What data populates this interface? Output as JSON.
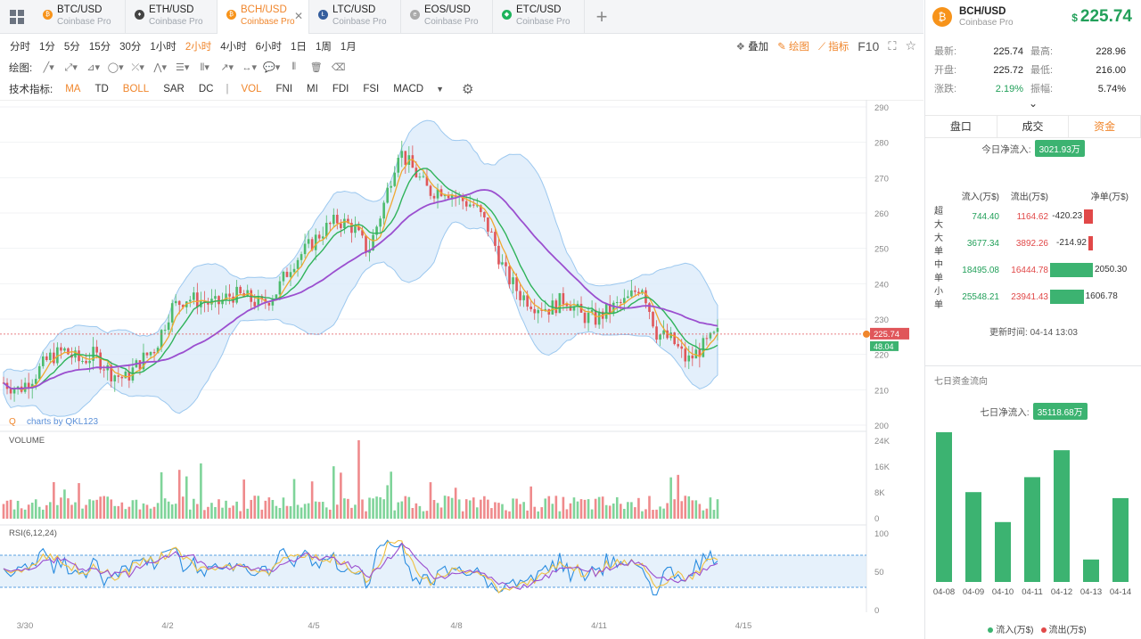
{
  "tabs": [
    {
      "pair": "BTC/USD",
      "exchange": "Coinbase Pro",
      "color": "#f7931a",
      "glyph": "₿",
      "active": false
    },
    {
      "pair": "ETH/USD",
      "exchange": "Coinbase Pro",
      "color": "#444444",
      "glyph": "♦",
      "active": false
    },
    {
      "pair": "BCH/USD",
      "exchange": "Coinbase Pro",
      "color": "#f7931a",
      "glyph": "₿",
      "active": true
    },
    {
      "pair": "LTC/USD",
      "exchange": "Coinbase Pro",
      "color": "#345d9d",
      "glyph": "Ł",
      "active": false
    },
    {
      "pair": "EOS/USD",
      "exchange": "Coinbase Pro",
      "color": "#aaaaaa",
      "glyph": "e",
      "active": false
    },
    {
      "pair": "ETC/USD",
      "exchange": "Coinbase Pro",
      "color": "#1db35c",
      "glyph": "◆",
      "active": false
    }
  ],
  "intervals": [
    "分时",
    "1分",
    "5分",
    "15分",
    "30分",
    "1小时",
    "2小时",
    "4小时",
    "6小时",
    "1日",
    "1周",
    "1月"
  ],
  "active_interval": "2小时",
  "row1_right": {
    "overlay": "叠加",
    "draw": "绘图",
    "indicator": "指标",
    "f10": "F10"
  },
  "draw_label": "绘图:",
  "tech_label": "技术指标:",
  "indicators": [
    {
      "name": "MA",
      "active": true
    },
    {
      "name": "TD",
      "active": false
    },
    {
      "name": "BOLL",
      "active": true
    },
    {
      "name": "SAR",
      "active": false
    },
    {
      "name": "DC",
      "active": false
    },
    {
      "name": "|",
      "active": false
    },
    {
      "name": "VOL",
      "active": true
    },
    {
      "name": "FNI",
      "active": false
    },
    {
      "name": "MI",
      "active": false
    },
    {
      "name": "FDI",
      "active": false
    },
    {
      "name": "FSI",
      "active": false
    },
    {
      "name": "MACD",
      "active": false
    }
  ],
  "chart": {
    "watermark": "charts by QKL123",
    "price_axis": [
      "290",
      "280",
      "270",
      "260",
      "250",
      "240",
      "230",
      "220",
      "210",
      "200"
    ],
    "volume_label": "VOLUME",
    "volume_axis": [
      "24K",
      "16K",
      "8K",
      "0"
    ],
    "rsi_label": "RSI(6,12,24)",
    "rsi_axis": [
      "100",
      "50",
      "0"
    ],
    "date_labels": [
      "3/30",
      "4/2",
      "4/5",
      "4/8",
      "4/11",
      "4/15"
    ],
    "last_price_tag": "225.74",
    "ma_tag": "48.04"
  },
  "chart_data": {
    "type": "candlestick",
    "x_labels": [
      "3/30",
      "4/2",
      "4/5",
      "4/8",
      "4/11",
      "4/15"
    ],
    "ylim": [
      200,
      290
    ],
    "close_path": [
      212,
      210,
      214,
      219,
      221,
      218,
      220,
      215,
      213,
      218,
      222,
      233,
      236,
      235,
      234,
      237,
      236,
      234,
      238,
      246,
      250,
      255,
      258,
      256,
      249,
      262,
      278,
      272,
      266,
      267,
      264,
      262,
      255,
      243,
      237,
      234,
      233,
      236,
      231,
      230,
      233,
      235,
      240,
      226,
      224,
      218,
      222,
      225.74
    ],
    "last_price": 225.74
  },
  "side": {
    "pair": "BCH/USD",
    "exchange": "Coinbase Pro",
    "currency": "$",
    "price": "225.74",
    "stats": [
      {
        "l1": "最新:",
        "v1": "225.74",
        "l2": "最高:",
        "v2": "228.96",
        "g": false
      },
      {
        "l1": "开盘:",
        "v1": "225.72",
        "l2": "最低:",
        "v2": "216.00",
        "g": false
      },
      {
        "l1": "涨跌:",
        "v1": "2.19%",
        "l2": "振幅:",
        "v2": "5.74%",
        "g": true
      }
    ],
    "caret": "⌄",
    "subtabs": [
      "盘口",
      "成交",
      "资金"
    ],
    "active_subtab": "资金",
    "today_label": "今日净流入:",
    "today_value": "3021.93万",
    "flow_headers": [
      "流入(万$)",
      "流出(万$)",
      "净单(万$)"
    ],
    "flows": [
      {
        "type": "超大",
        "in": "744.40",
        "out": "1164.62",
        "net": "-420.23",
        "netval": -420.23
      },
      {
        "type": "大单",
        "in": "3677.34",
        "out": "3892.26",
        "net": "-214.92",
        "netval": -214.92
      },
      {
        "type": "中单",
        "in": "18495.08",
        "out": "16444.78",
        "net": "2050.30",
        "netval": 2050.3
      },
      {
        "type": "小单",
        "in": "25548.21",
        "out": "23941.43",
        "net": "1606.78",
        "netval": 1606.78
      }
    ],
    "update_label": "更新时间:",
    "update_time": "04-14 13:03",
    "week_title": "七日资金流向",
    "week_label": "七日净流入:",
    "week_value": "35118.68万",
    "week_legend_in": "流入(万$)",
    "week_legend_out": "流出(万$)"
  },
  "week_chart": {
    "type": "bar",
    "categories": [
      "04-08",
      "04-09",
      "04-10",
      "04-11",
      "04-12",
      "04-13",
      "04-14"
    ],
    "values": [
      100,
      60,
      40,
      70,
      88,
      15,
      56
    ],
    "colors": {
      "in": "#3cb371",
      "out": "#e14848"
    }
  }
}
